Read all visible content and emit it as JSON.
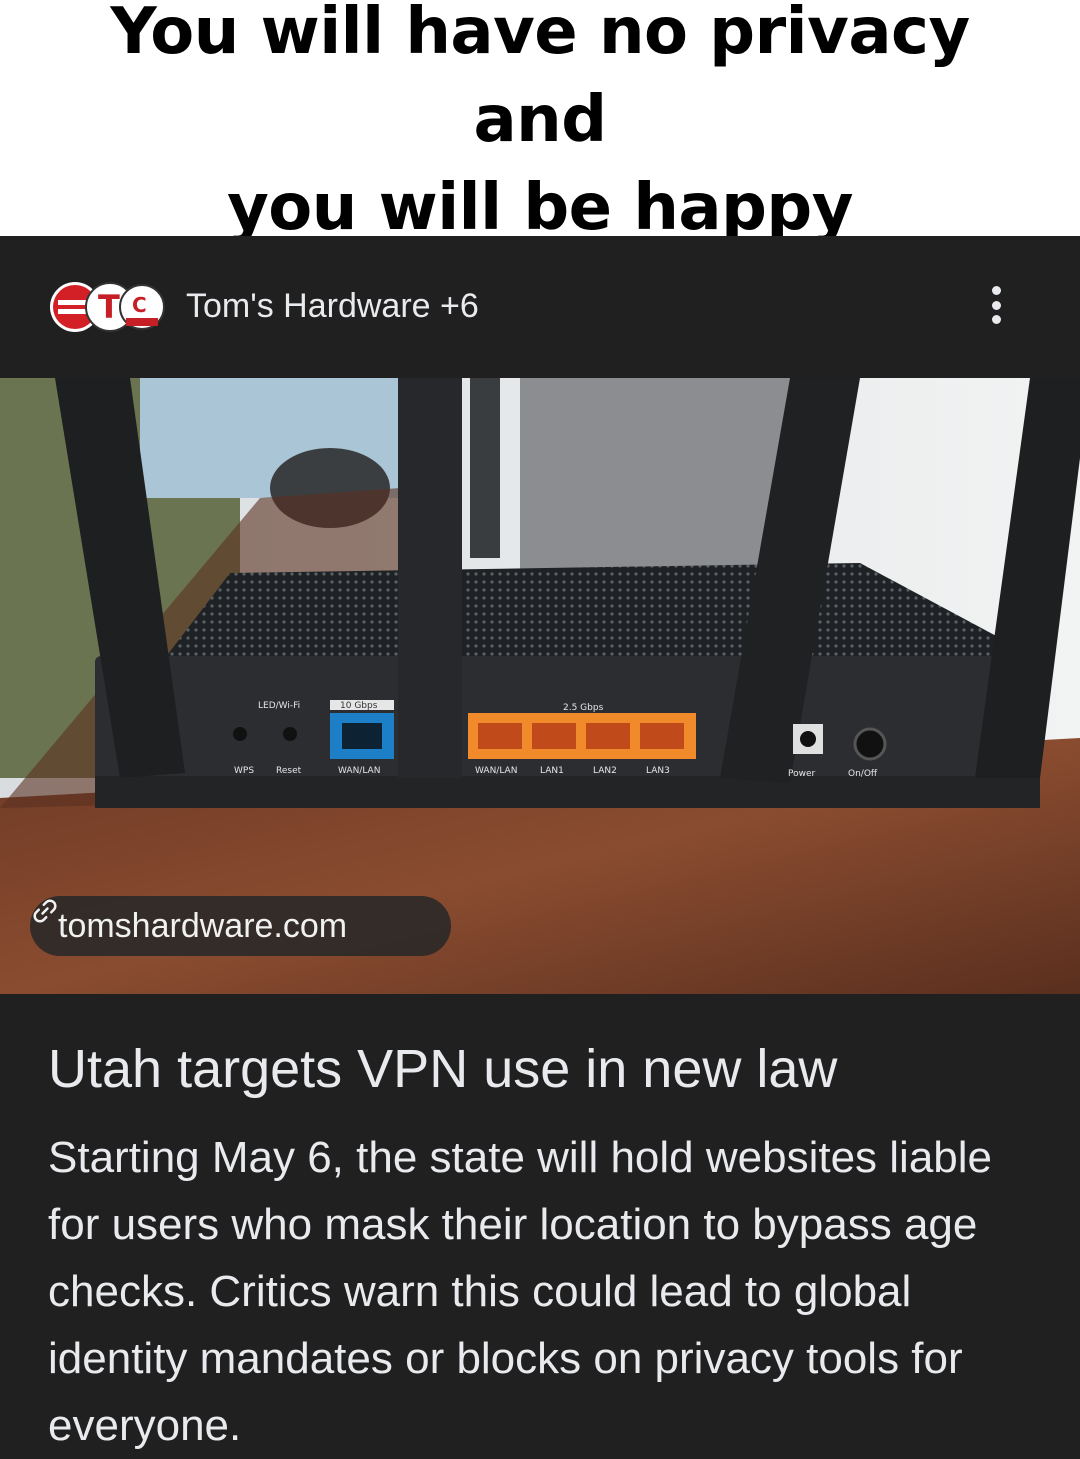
{
  "meme": {
    "caption_line1": "You will have no privacy and",
    "caption_line2": "you will be happy"
  },
  "card": {
    "source": {
      "logo_icon": "publisher-logos-icon",
      "name": "Tom's Hardware +6"
    },
    "more_icon": "more-vertical-icon",
    "image": {
      "alt_subject": "router-rear-ports-photo",
      "port_labels": {
        "led": "LED/Wi-Fi",
        "ten_g": "10 Gbps",
        "wps": "WPS",
        "reset": "Reset",
        "wanlan": "WAN/LAN",
        "two5g": "2.5 Gbps",
        "wanlan2": "WAN/LAN",
        "lan1": "LAN1",
        "lan2": "LAN2",
        "lan3": "LAN3",
        "power": "Power",
        "onoff": "On/Off"
      }
    },
    "link_chip": {
      "icon": "link-icon",
      "label": "tomshardware.com"
    },
    "headline": "Utah targets VPN use in new law",
    "summary": "Starting May 6, the state will hold websites liable for users who mask their location to bypass age checks. Critics warn this could lead to global identity mandates or blocks on privacy tools for everyone."
  },
  "colors": {
    "card_bg": "#202020",
    "text": "#e8eaed",
    "caption_bg": "#ffffff",
    "caption_text": "#000000",
    "port_blue": "#1c7fc8",
    "port_orange": "#f08a2a"
  }
}
